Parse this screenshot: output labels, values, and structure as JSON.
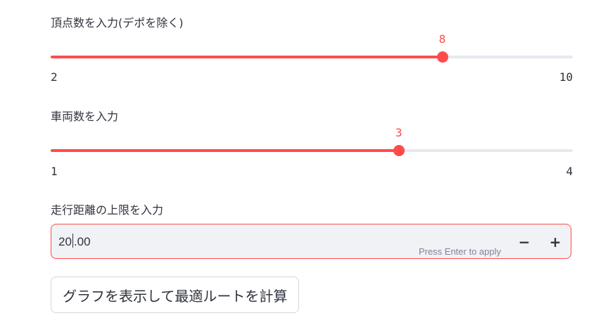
{
  "vertices_slider": {
    "label": "頂点数を入力(デポを除く)",
    "min": 2,
    "max": 10,
    "value": 8,
    "min_label": "2",
    "max_label": "10",
    "value_label": "8"
  },
  "vehicles_slider": {
    "label": "車両数を入力",
    "min": 1,
    "max": 4,
    "value": 3,
    "min_label": "1",
    "max_label": "4",
    "value_label": "3"
  },
  "distance_input": {
    "label": "走行距離の上限を入力",
    "value_before_caret": "20",
    "value_after_caret": ".00",
    "hint": "Press Enter to apply",
    "minus_label": "−",
    "plus_label": "+"
  },
  "action_button": {
    "label": "グラフを表示して最適ルートを計算"
  },
  "colors": {
    "accent": "#ff4b4b",
    "track": "#e6e9ef",
    "input_bg": "#f0f2f6",
    "text": "#31333f"
  }
}
